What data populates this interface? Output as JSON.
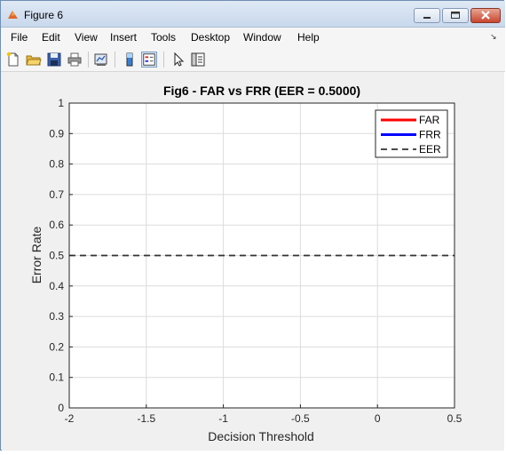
{
  "window": {
    "title": "Figure 6"
  },
  "menu": {
    "items": [
      "File",
      "Edit",
      "View",
      "Insert",
      "Tools",
      "Desktop",
      "Window",
      "Help"
    ]
  },
  "toolbar": {
    "icons": [
      "new-figure-icon",
      "open-file-icon",
      "save-icon",
      "print-icon",
      "link-plot-icon",
      "colorbar-icon",
      "legend-icon",
      "pointer-icon",
      "property-inspector-icon"
    ]
  },
  "chart_data": {
    "type": "line",
    "title": "Fig6 - FAR vs FRR (EER = 0.5000)",
    "xlabel": "Decision Threshold",
    "ylabel": "Error Rate",
    "xlim": [
      -2,
      0.5
    ],
    "ylim": [
      0,
      1
    ],
    "xticks": [
      "-2",
      "-1.5",
      "-1",
      "-0.5",
      "0",
      "0.5"
    ],
    "yticks": [
      "0",
      "0.1",
      "0.2",
      "0.3",
      "0.4",
      "0.5",
      "0.6",
      "0.7",
      "0.8",
      "0.9",
      "1"
    ],
    "grid": true,
    "legend_position": "top-right",
    "series": [
      {
        "name": "FAR",
        "color": "#ff0000",
        "style": "solid",
        "x": [],
        "y": []
      },
      {
        "name": "FRR",
        "color": "#0000ff",
        "style": "solid",
        "x": [],
        "y": []
      },
      {
        "name": "EER",
        "color": "#333333",
        "style": "dashed",
        "x": [
          -2,
          0.5
        ],
        "y": [
          0.5,
          0.5
        ]
      }
    ]
  }
}
